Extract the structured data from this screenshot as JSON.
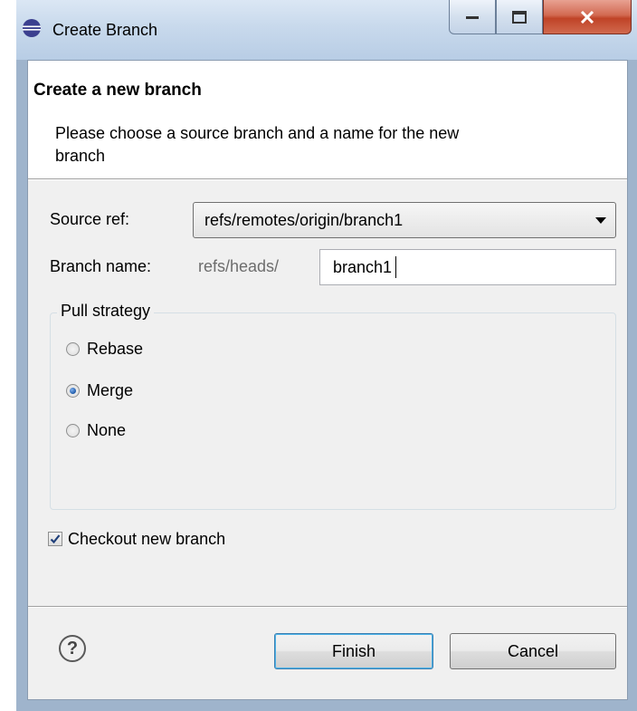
{
  "window": {
    "title": "Create Branch",
    "minimize_glyph": "—",
    "maximize_glyph": "▫",
    "close_glyph": "X"
  },
  "banner": {
    "title": "Create a new branch",
    "description": "Please choose a source branch and a name for the new branch"
  },
  "form": {
    "source_ref_label": "Source ref:",
    "source_ref_value": "refs/remotes/origin/branch1",
    "branch_name_label": "Branch name:",
    "branch_prefix": "refs/heads/",
    "branch_name_value": "branch1"
  },
  "pull_strategy": {
    "title": "Pull strategy",
    "options": [
      "Rebase",
      "Merge",
      "None"
    ],
    "selected": "Merge"
  },
  "checkout": {
    "label": "Checkout new branch",
    "checked": true
  },
  "buttons": {
    "help_glyph": "?",
    "finish": "Finish",
    "cancel": "Cancel"
  }
}
